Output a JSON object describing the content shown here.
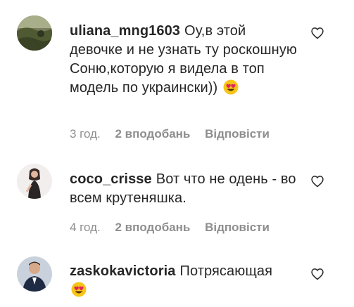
{
  "comments": [
    {
      "username": "uliana_mng1603",
      "text": "Оу,в этой девочке и не узнать ту роскошную Соню,которую я видела в топ модель по украински))",
      "emoji": "heart-eyes-emoji",
      "time": "3 год.",
      "likes": "2 вподобань",
      "reply": "Відповісти",
      "avatar": "landscape-avatar"
    },
    {
      "username": "coco_crisse",
      "text": "Вот что не одень - во всем крутеняшка.",
      "time": "4 год.",
      "likes": "2 вподобань",
      "reply": "Відповісти",
      "avatar": "woman-avatar"
    },
    {
      "username": "zaskokavictoria",
      "text": "Потрясающая",
      "emoji": "heart-eyes-emoji",
      "avatar": "man-avatar"
    }
  ],
  "colors": {
    "text": "#262626",
    "meta": "#8e8e8e",
    "emoji_face": "#f5c518",
    "emoji_heart": "#e0245e"
  }
}
